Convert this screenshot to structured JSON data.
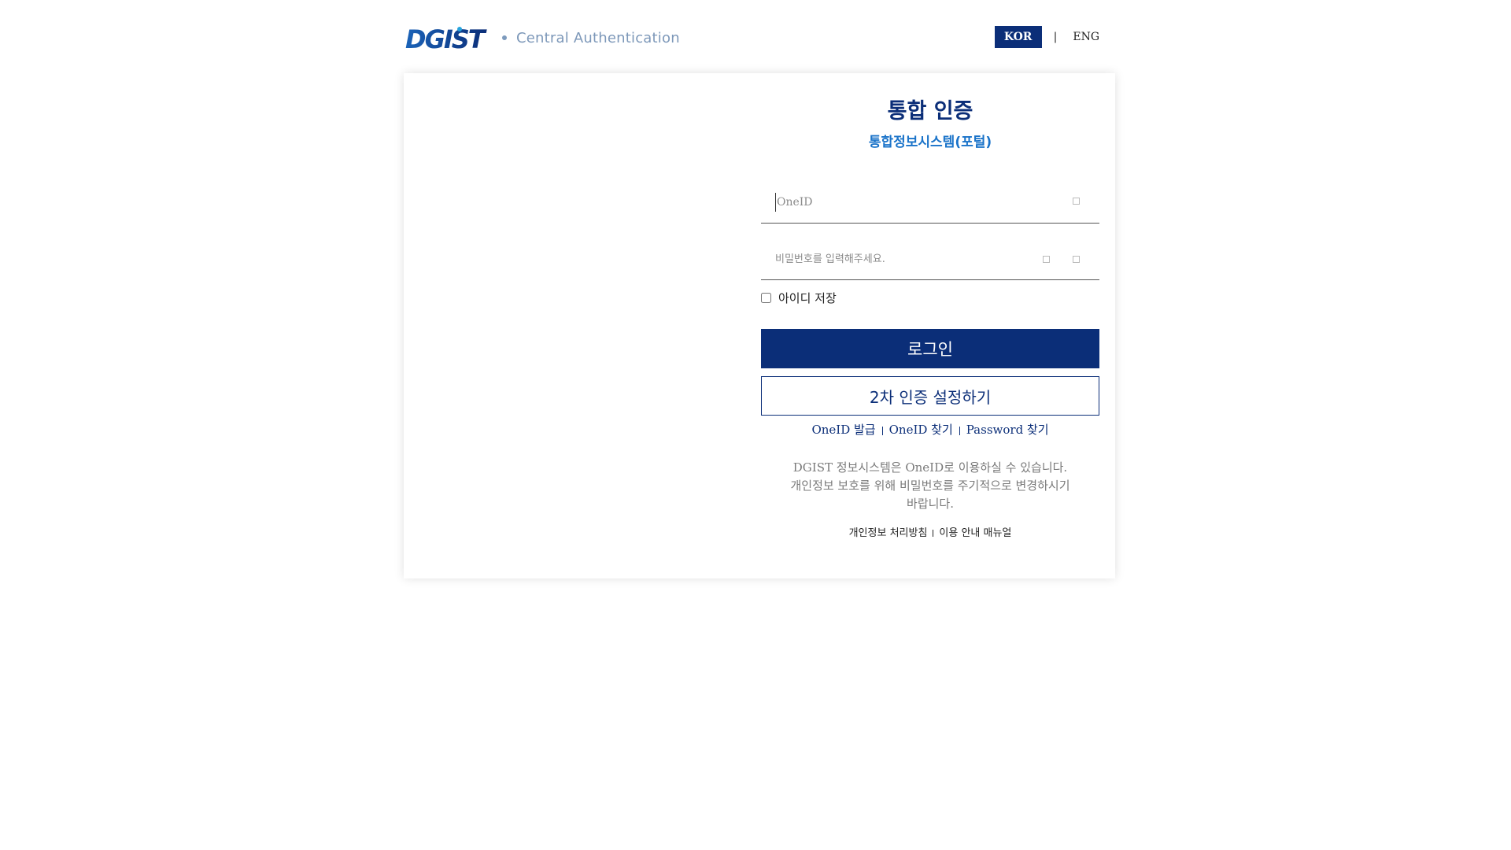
{
  "header": {
    "logo_text": "DGIST",
    "subtitle": "Central Authentication",
    "lang_kor": "KOR",
    "lang_separator": "|",
    "lang_eng": "ENG"
  },
  "login": {
    "title": "통합 인증",
    "subtitle": "통합정보시스템(포털)",
    "id_placeholder": "OneID",
    "password_placeholder": "비밀번호를 입력해주세요.",
    "remember_label": "아이디 저장",
    "remember_checked": false,
    "login_button": "로그인",
    "mfa_button": "2차 인증 설정하기"
  },
  "account_links": [
    "OneID 발급",
    "OneID 찾기",
    "Password 찾기"
  ],
  "notice": [
    "DGIST 정보시스템은 OneID로 이용하실 수 있습니다.",
    "개인정보 보호를 위해 비밀번호를 주기적으로 변경하시기",
    "바랍니다."
  ],
  "footer_links": [
    "개인정보 처리방침",
    "이용 안내 매뉴얼"
  ],
  "icons": {
    "id_clear": "clear-icon",
    "password_toggle": "eye-icon",
    "password_clear": "clear-icon"
  },
  "colors": {
    "primary": "#0b2e78",
    "accent": "#1a73c9",
    "muted": "#7a7a7a"
  }
}
